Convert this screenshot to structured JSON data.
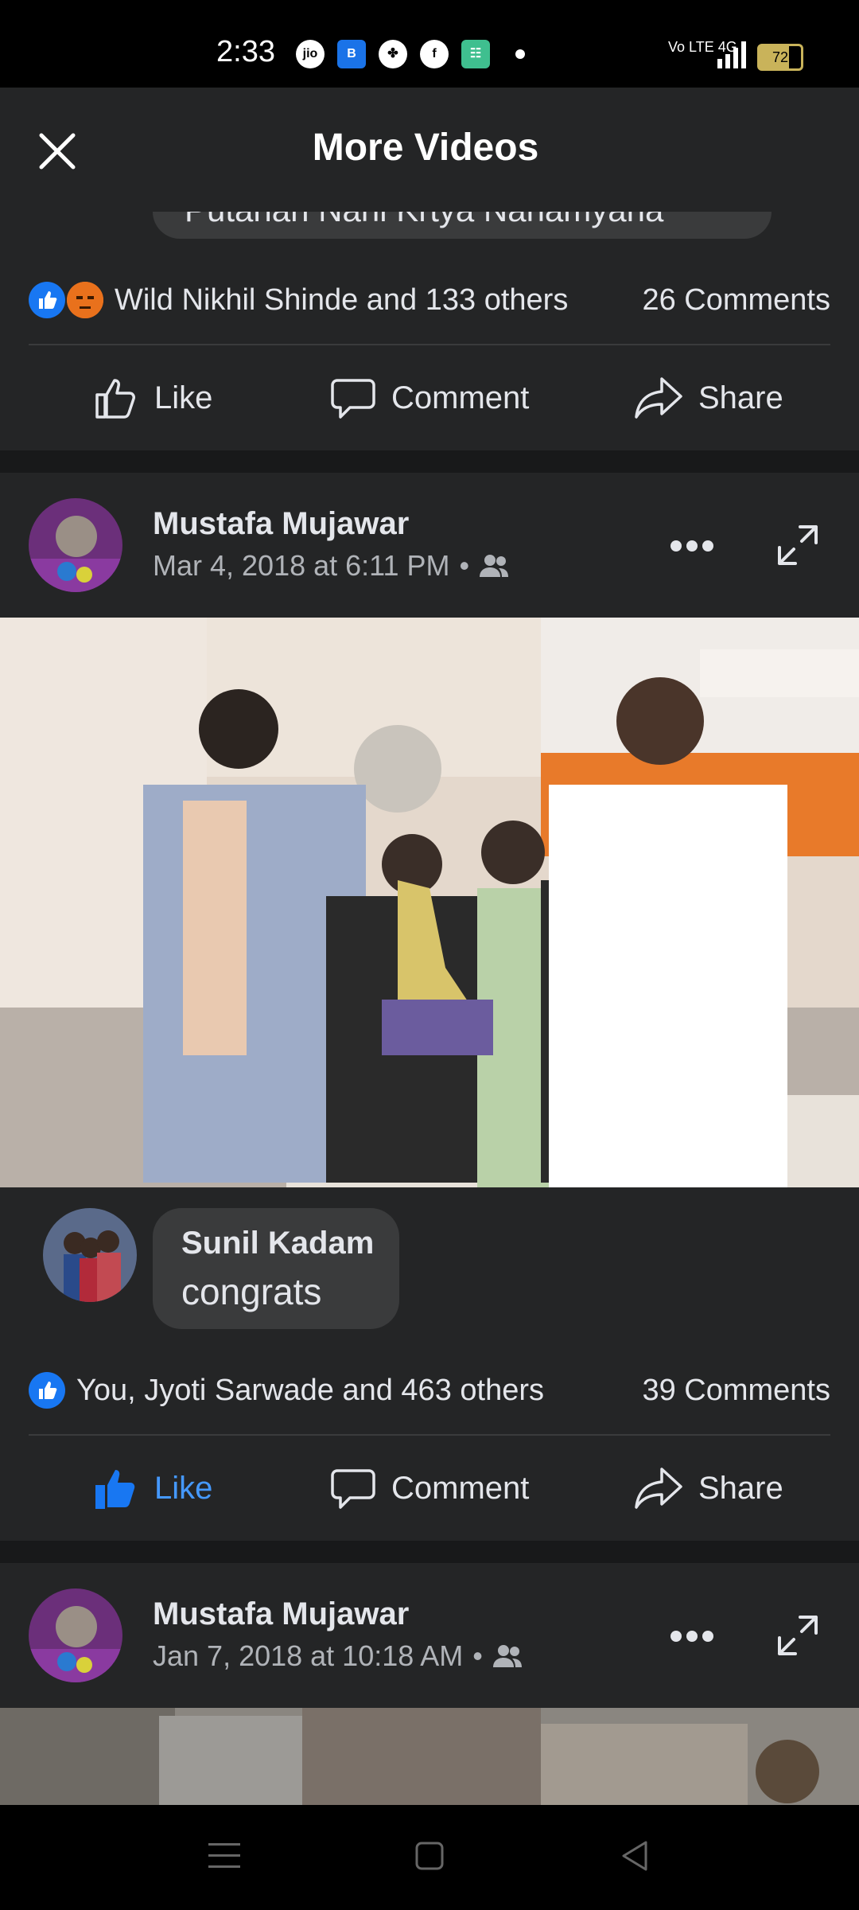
{
  "status_bar": {
    "time": "2:33",
    "icons": [
      "jio-icon",
      "b-app-icon",
      "clover-icon",
      "facebook-icon",
      "green-app-icon",
      "dot-icon"
    ],
    "signal_text": "Vo LTE 4G",
    "battery": "72"
  },
  "header": {
    "title": "More Videos",
    "close_icon": "close-icon"
  },
  "post1": {
    "partial_comment": "Putanan Nahi Krtya Nahamyana",
    "reactions_text": "Wild Nikhil Shinde and 133 others",
    "comments": "26 Comments",
    "actions": {
      "like": "Like",
      "comment": "Comment",
      "share": "Share"
    }
  },
  "post2": {
    "author": "Mustafa Mujawar",
    "timestamp": "Mar 4, 2018 at 6:11 PM",
    "privacy_icon": "friends-icon",
    "comment": {
      "author": "Sunil Kadam",
      "text": "congrats"
    },
    "reactions_text": "You, Jyoti Sarwade and 463 others",
    "comments": "39 Comments",
    "actions": {
      "like": "Like",
      "comment": "Comment",
      "share": "Share"
    },
    "like_active": true
  },
  "post3": {
    "author": "Mustafa Mujawar",
    "timestamp": "Jan 7, 2018 at 10:18 AM",
    "privacy_icon": "friends-icon"
  },
  "colors": {
    "background": "#18191a",
    "card": "#242526",
    "accent": "#1877f2",
    "text": "#e4e6eb",
    "secondary_text": "#b0b3b8"
  }
}
